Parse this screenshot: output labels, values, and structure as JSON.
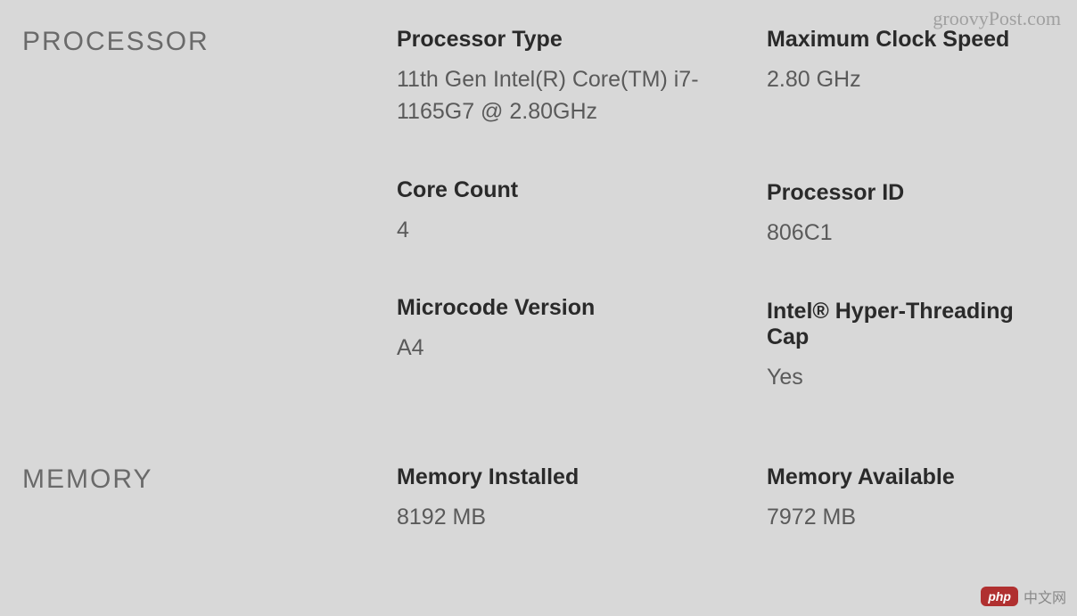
{
  "watermarks": {
    "top": "groovyPost.com",
    "bottom_badge": "php",
    "bottom_text": "中文网"
  },
  "sections": {
    "processor": {
      "label": "PROCESSOR",
      "fields": {
        "processor_type": {
          "label": "Processor Type",
          "value": "11th Gen Intel(R) Core(TM) i7-1165G7 @ 2.80GHz"
        },
        "max_clock_speed": {
          "label": "Maximum Clock Speed",
          "value": "2.80 GHz"
        },
        "core_count": {
          "label": "Core Count",
          "value": "4"
        },
        "processor_id": {
          "label": "Processor ID",
          "value": "806C1"
        },
        "microcode_version": {
          "label": "Microcode Version",
          "value": "A4"
        },
        "hyper_threading": {
          "label": "Intel® Hyper-Threading Cap",
          "value": "Yes"
        }
      }
    },
    "memory": {
      "label": "MEMORY",
      "fields": {
        "memory_installed": {
          "label": "Memory Installed",
          "value": "8192 MB"
        },
        "memory_available": {
          "label": "Memory Available",
          "value": "7972 MB"
        }
      }
    }
  }
}
